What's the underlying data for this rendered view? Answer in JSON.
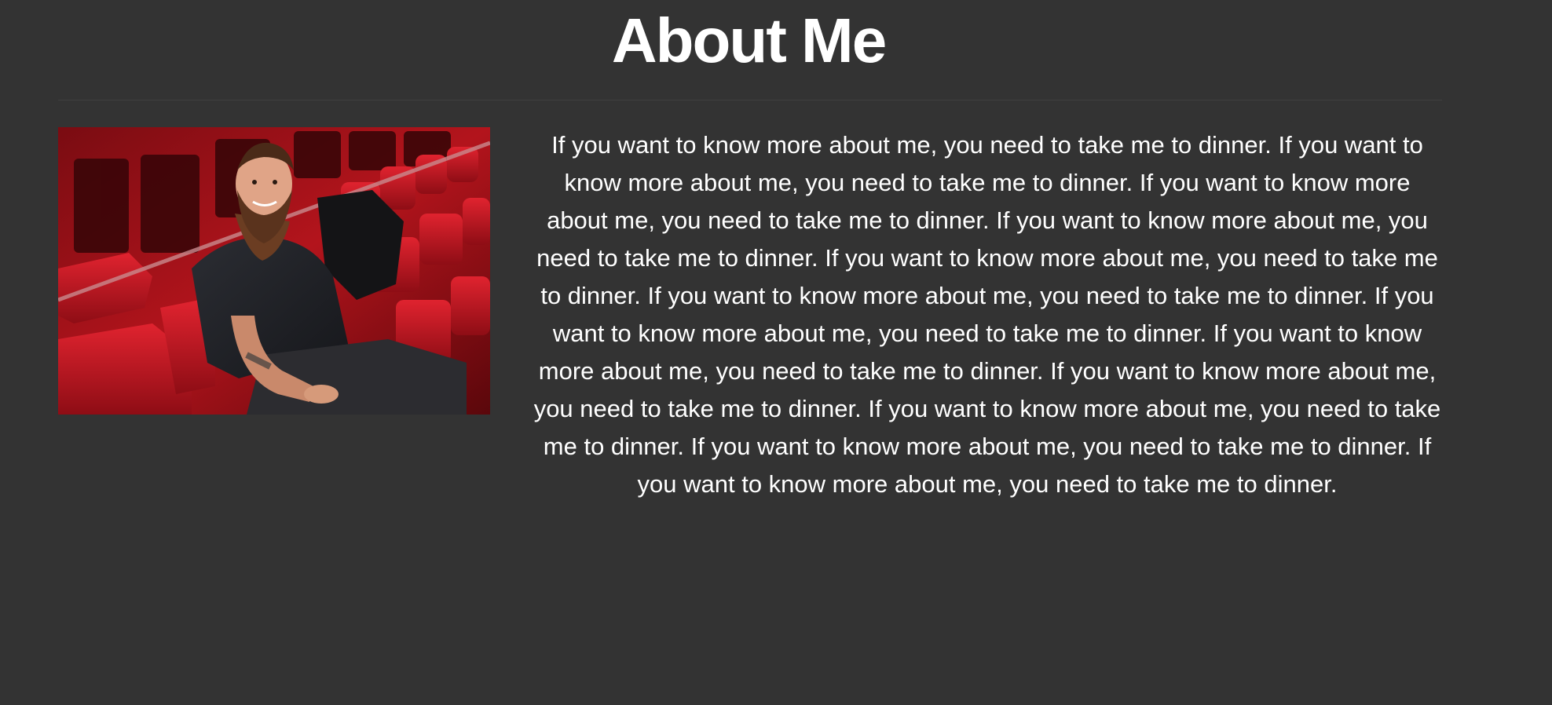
{
  "page": {
    "title": "About Me",
    "background_color": "#333333",
    "text_color": "#ffffff"
  },
  "profile_photo": {
    "icon": "person-photo"
  },
  "about": {
    "text": "If you want to know more about me, you need to take me to dinner. If you want to know more about me, you need to take me to dinner. If you want to know more about me, you need to take me to dinner. If you want to know more about me, you need to take me to dinner. If you want to know more about me, you need to take me to dinner. If you want to know more about me, you need to take me to dinner. If you want to know more about me, you need to take me to dinner. If you want to know more about me, you need to take me to dinner. If you want to know more about me, you need to take me to dinner. If you want to know more about me, you need to take me to dinner. If you want to know more about me, you need to take me to dinner. If you want to know more about me, you need to take me to dinner."
  }
}
